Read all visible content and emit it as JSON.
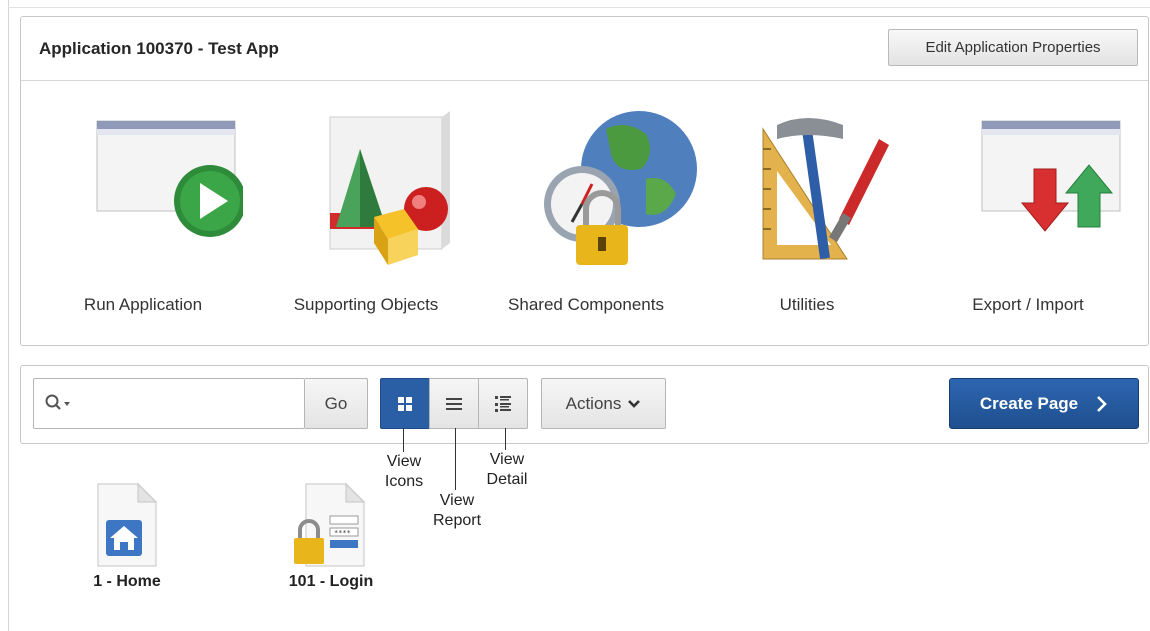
{
  "app": {
    "title": "Application 100370 - Test App",
    "edit_button": "Edit Application Properties"
  },
  "tiles": [
    {
      "label": "Run Application",
      "icon": "run-application-icon"
    },
    {
      "label": "Supporting Objects",
      "icon": "supporting-objects-icon"
    },
    {
      "label": "Shared Components",
      "icon": "shared-components-icon"
    },
    {
      "label": "Utilities",
      "icon": "utilities-icon"
    },
    {
      "label": "Export / Import",
      "icon": "export-import-icon"
    }
  ],
  "toolbar": {
    "search_placeholder": "",
    "go_label": "Go",
    "actions_label": "Actions",
    "create_label": "Create Page"
  },
  "view_modes": [
    {
      "name": "icons",
      "active": true
    },
    {
      "name": "report",
      "active": false
    },
    {
      "name": "detail",
      "active": false
    }
  ],
  "callouts": {
    "icons": [
      "View",
      "Icons"
    ],
    "report": [
      "View",
      "Report"
    ],
    "detail": [
      "View",
      "Detail"
    ]
  },
  "pages": [
    {
      "label": "1 - Home",
      "icon": "home-page-icon"
    },
    {
      "label": "101 - Login",
      "icon": "login-page-icon"
    }
  ],
  "colors": {
    "accent": "#2a5fa6",
    "create_button": "#1f4f8f"
  }
}
